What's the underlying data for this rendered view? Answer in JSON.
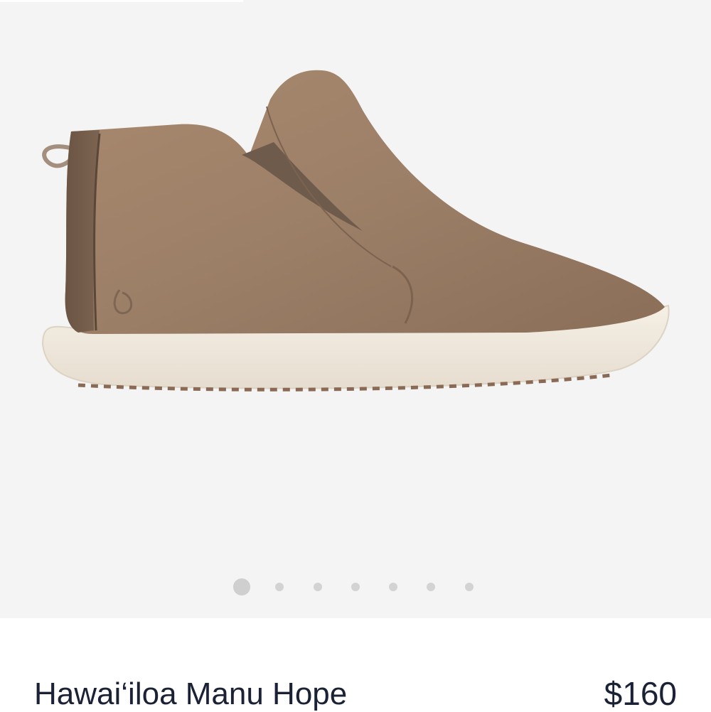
{
  "product": {
    "title": "Hawai‘iloa Manu Hope",
    "price": "$160",
    "image_icon": "slip-on-chukka-shoe-image"
  },
  "gallery": {
    "image_count": 7,
    "active_index": 0,
    "colors": {
      "background": "#f4f4f4",
      "dot_active": "#cfcfcf",
      "dot_inactive": "#d6d6d6",
      "leather": "#9b7e67",
      "leather_dark": "#6f5847",
      "sole": "#f1ebe0",
      "text": "#1b2236"
    }
  }
}
